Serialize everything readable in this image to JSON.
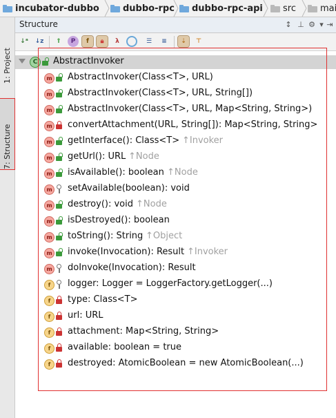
{
  "breadcrumbs": [
    {
      "label": "incubator-dubbo",
      "icon": "module-folder-icon"
    },
    {
      "label": "dubbo-rpc",
      "icon": "module-folder-icon"
    },
    {
      "label": "dubbo-rpc-api",
      "icon": "module-folder-icon"
    },
    {
      "label": "src",
      "icon": "folder-icon"
    },
    {
      "label": "mai",
      "icon": "folder-icon"
    }
  ],
  "side_tabs": {
    "project": "1: Project",
    "structure": "7: Structure"
  },
  "panel": {
    "title": "Structure"
  },
  "toolbar": {
    "buttons": [
      "sort-visibility-icon",
      "sort-alpha-icon",
      "show-inherited-icon",
      "show-properties-icon",
      "show-fields-icon",
      "show-non-public-icon",
      "show-lambdas-icon",
      "show-anonymous-icon",
      "expand-all-icon",
      "collapse-all-icon",
      "autoscroll-to-source-icon",
      "autoscroll-from-source-icon"
    ]
  },
  "tree": {
    "root": {
      "label": "AbstractInvoker",
      "icon": "abstract-class-icon"
    },
    "members": [
      {
        "kind": "m",
        "visibility": "public",
        "text": "AbstractInvoker(Class<T>, URL)",
        "suffix": ""
      },
      {
        "kind": "m",
        "visibility": "public",
        "text": "AbstractInvoker(Class<T>, URL, String[])",
        "suffix": ""
      },
      {
        "kind": "m",
        "visibility": "public",
        "text": "AbstractInvoker(Class<T>, URL, Map<String, String>)",
        "suffix": ""
      },
      {
        "kind": "m",
        "visibility": "private",
        "text": "convertAttachment(URL, String[]): Map<String, String>",
        "suffix": "",
        "static": true
      },
      {
        "kind": "m",
        "visibility": "public",
        "text": "getInterface(): Class<T>",
        "suffix": "↑Invoker"
      },
      {
        "kind": "m",
        "visibility": "public",
        "text": "getUrl(): URL",
        "suffix": "↑Node"
      },
      {
        "kind": "m",
        "visibility": "public",
        "text": "isAvailable(): boolean",
        "suffix": "↑Node"
      },
      {
        "kind": "m",
        "visibility": "protected",
        "text": "setAvailable(boolean): void",
        "suffix": ""
      },
      {
        "kind": "m",
        "visibility": "public",
        "text": "destroy(): void",
        "suffix": "↑Node"
      },
      {
        "kind": "m",
        "visibility": "public",
        "text": "isDestroyed(): boolean",
        "suffix": ""
      },
      {
        "kind": "m",
        "visibility": "public",
        "text": "toString(): String",
        "suffix": "↑Object"
      },
      {
        "kind": "m",
        "visibility": "public",
        "text": "invoke(Invocation): Result",
        "suffix": "↑Invoker"
      },
      {
        "kind": "m",
        "visibility": "protected",
        "text": "doInvoke(Invocation): Result",
        "suffix": ""
      },
      {
        "kind": "f",
        "visibility": "protected",
        "text": "logger: Logger = LoggerFactory.getLogger(...)",
        "suffix": "",
        "static": true
      },
      {
        "kind": "f",
        "visibility": "private",
        "text": "type: Class<T>",
        "suffix": "",
        "static": true
      },
      {
        "kind": "f",
        "visibility": "private",
        "text": "url: URL",
        "suffix": "",
        "static": true
      },
      {
        "kind": "f",
        "visibility": "private",
        "text": "attachment: Map<String, String>",
        "suffix": "",
        "static": true
      },
      {
        "kind": "f",
        "visibility": "private",
        "text": "available: boolean = true",
        "suffix": ""
      },
      {
        "kind": "f",
        "visibility": "private",
        "text": "destroyed: AtomicBoolean = new AtomicBoolean(...)",
        "suffix": ""
      }
    ]
  },
  "colors": {
    "highlight": "#e03030",
    "selected_row": "#d4d4d4",
    "method": "#f6a8a0",
    "field": "#f7d58a",
    "inherited_suffix": "#a0a0a0"
  }
}
